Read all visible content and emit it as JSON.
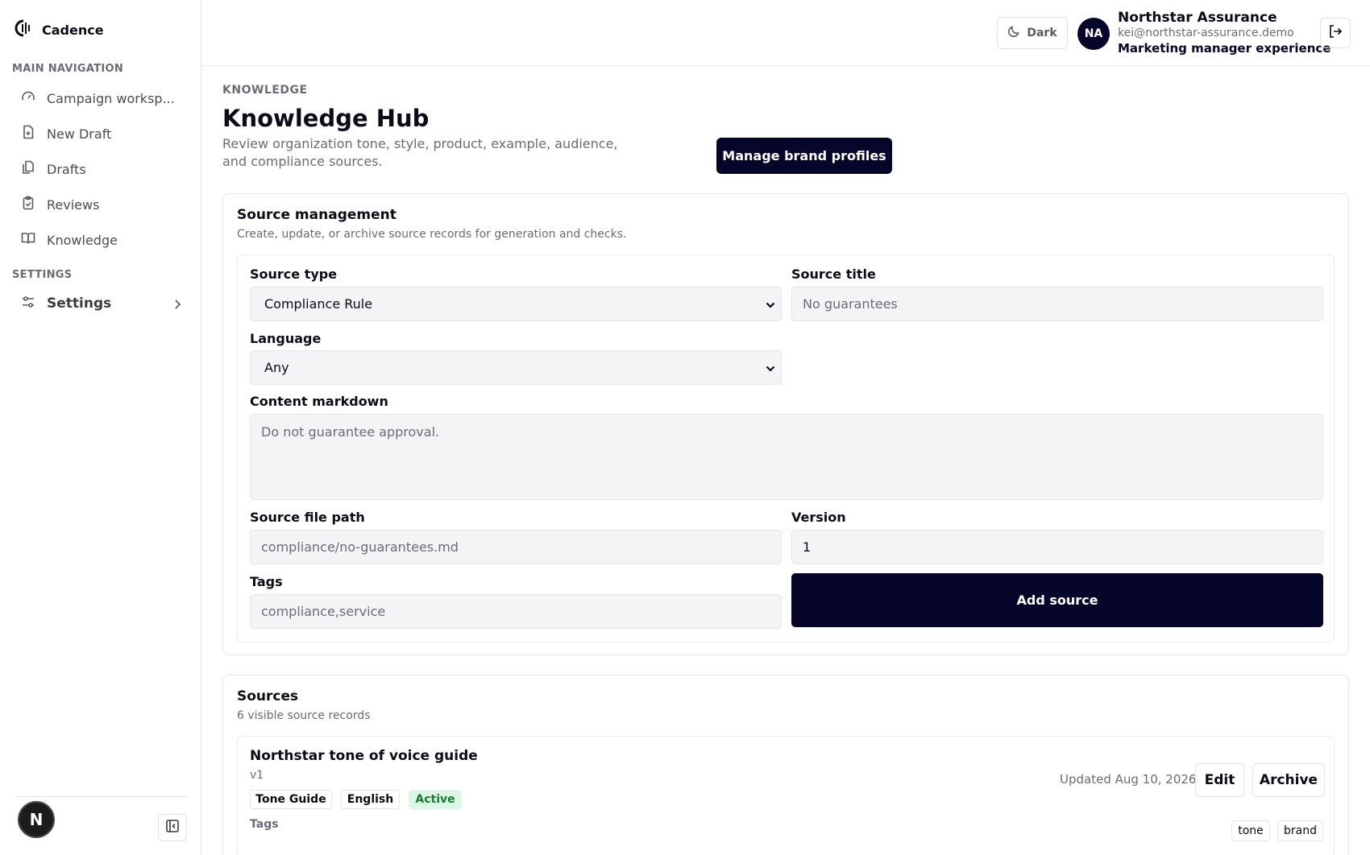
{
  "app": {
    "name": "Cadence"
  },
  "sidebar": {
    "main_section": "MAIN NAVIGATION",
    "items": [
      {
        "label": "Campaign worksp...",
        "icon": "gauge-icon"
      },
      {
        "label": "New Draft",
        "icon": "file-plus-icon"
      },
      {
        "label": "Drafts",
        "icon": "files-icon"
      },
      {
        "label": "Reviews",
        "icon": "clipboard-check-icon"
      },
      {
        "label": "Knowledge",
        "icon": "book-open-icon"
      }
    ],
    "settings_section": "SETTINGS",
    "settings_label": "Settings",
    "avatar_letter": "N"
  },
  "header": {
    "theme_toggle": "Dark",
    "user": {
      "initials": "NA",
      "name": "Northstar Assurance",
      "email": "kei@northstar-assurance.demo",
      "role": "Marketing manager experience"
    }
  },
  "page": {
    "eyebrow": "KNOWLEDGE",
    "title": "Knowledge Hub",
    "description": "Review organization tone, style, product, example, audience, and compliance sources.",
    "manage_button": "Manage brand profiles"
  },
  "source_management": {
    "title": "Source management",
    "subtitle": "Create, update, or archive source records for generation and checks.",
    "source_type_label": "Source type",
    "source_type_value": "Compliance Rule",
    "source_title_label": "Source title",
    "source_title_placeholder": "No guarantees",
    "language_label": "Language",
    "language_value": "Any",
    "content_label": "Content markdown",
    "content_placeholder": "Do not guarantee approval.",
    "file_path_label": "Source file path",
    "file_path_placeholder": "compliance/no-guarantees.md",
    "version_label": "Version",
    "version_value": "1",
    "tags_label": "Tags",
    "tags_placeholder": "compliance,service",
    "add_button": "Add source"
  },
  "sources": {
    "title": "Sources",
    "count_text": "6 visible source records",
    "items": [
      {
        "title": "Northstar tone of voice guide",
        "version": "v1",
        "type": "Tone Guide",
        "language": "English",
        "status": "Active",
        "updated": "Updated Aug 10, 2026",
        "edit_label": "Edit",
        "archive_label": "Archive",
        "tags_label": "Tags",
        "tags": [
          "tone",
          "brand"
        ]
      }
    ]
  },
  "colors": {
    "primary": "#06062a",
    "active_badge_bg": "#dcf7e3",
    "active_badge_text": "#157a3a"
  }
}
